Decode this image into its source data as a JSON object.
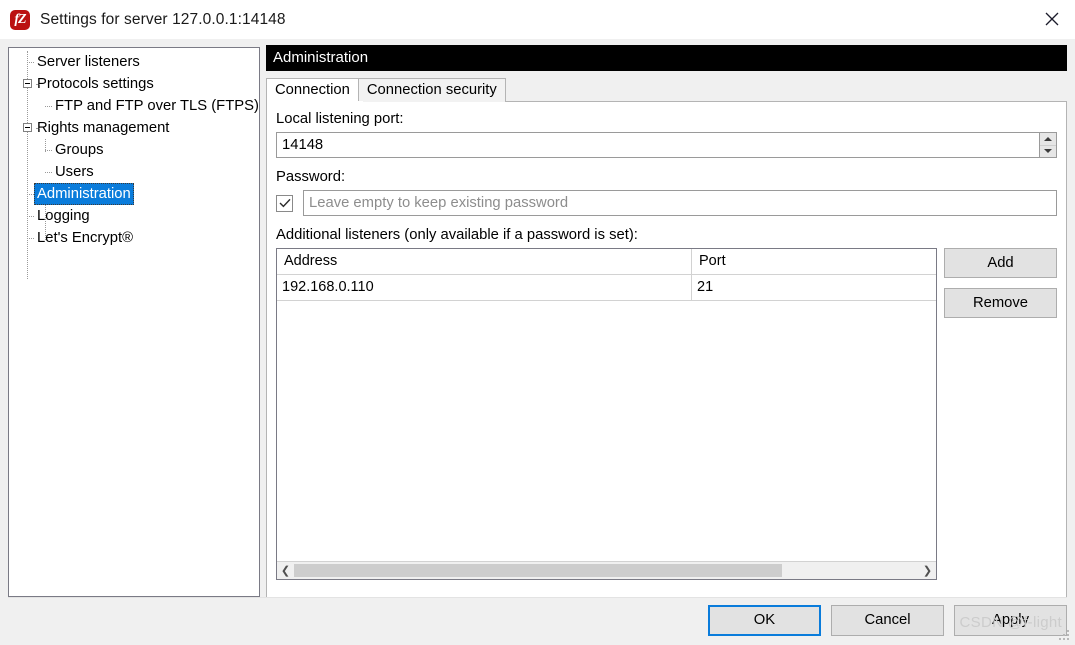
{
  "window": {
    "title": "Settings for server 127.0.0.1:14148",
    "app_icon": "filezilla-icon",
    "close_icon": "close-icon"
  },
  "sidebar": {
    "items": [
      {
        "label": "Server listeners",
        "level": 0,
        "expandable": false,
        "selected": false
      },
      {
        "label": "Protocols settings",
        "level": 0,
        "expandable": true,
        "selected": false
      },
      {
        "label": "FTP and FTP over TLS (FTPS)",
        "level": 1,
        "expandable": false,
        "selected": false
      },
      {
        "label": "Rights management",
        "level": 0,
        "expandable": true,
        "selected": false
      },
      {
        "label": "Groups",
        "level": 1,
        "expandable": false,
        "selected": false
      },
      {
        "label": "Users",
        "level": 1,
        "expandable": false,
        "selected": false
      },
      {
        "label": "Administration",
        "level": 0,
        "expandable": false,
        "selected": true
      },
      {
        "label": "Logging",
        "level": 0,
        "expandable": false,
        "selected": false
      },
      {
        "label": "Let's Encrypt®",
        "level": 0,
        "expandable": false,
        "selected": false
      }
    ]
  },
  "main": {
    "section_title": "Administration",
    "tabs": [
      {
        "label": "Connection",
        "active": true
      },
      {
        "label": "Connection security",
        "active": false
      }
    ],
    "port_field": {
      "label": "Local listening port:",
      "value": "14148",
      "spinner_up_icon": "arrow-up-icon",
      "spinner_down_icon": "arrow-down-icon"
    },
    "password_field": {
      "label": "Password:",
      "checkbox_checked": true,
      "check_icon": "check-icon",
      "value": "",
      "placeholder": "Leave empty to keep existing password"
    },
    "listeners": {
      "label": "Additional listeners (only available if a password is set):",
      "columns": [
        "Address",
        "Port"
      ],
      "rows": [
        {
          "address": "192.168.0.110",
          "port": "21"
        }
      ],
      "scroll_left_icon": "chevron-left-icon",
      "scroll_right_icon": "chevron-right-icon",
      "buttons": {
        "add": "Add",
        "remove": "Remove"
      }
    }
  },
  "footer": {
    "ok": "OK",
    "cancel": "Cancel",
    "apply": "Apply"
  },
  "watermark": {
    "text": "CSDN @f-light"
  },
  "colors": {
    "selection": "#0a7cdb",
    "header_bar": "#000000",
    "accent_icon": "#bb1111",
    "dialog_bg": "#f0f0f0"
  }
}
